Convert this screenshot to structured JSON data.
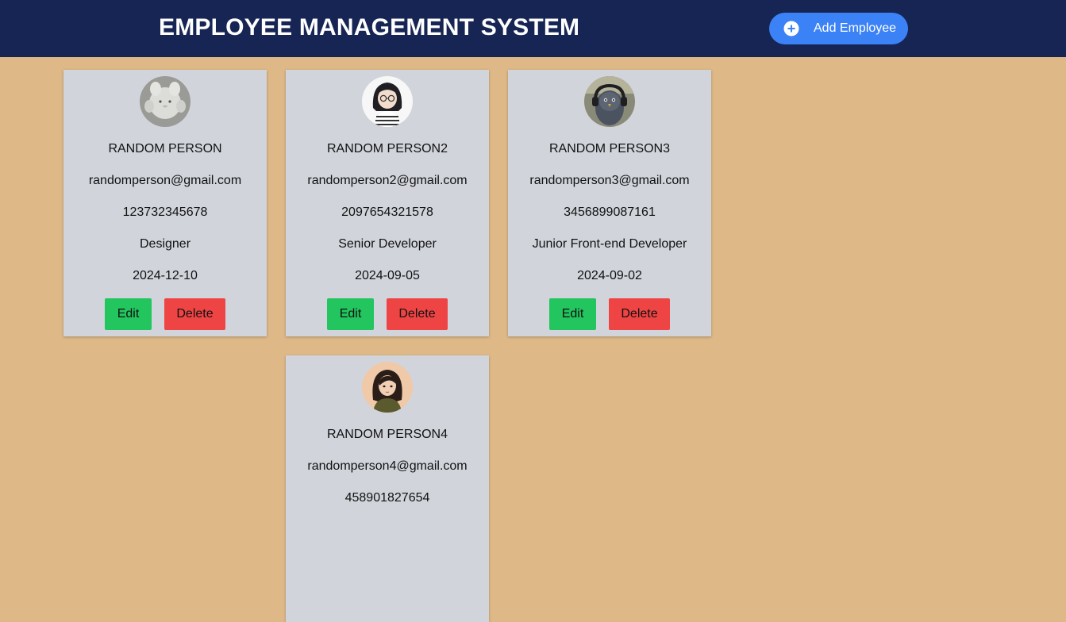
{
  "header": {
    "title": "EMPLOYEE MANAGEMENT SYSTEM",
    "add_button_label": "Add Employee"
  },
  "colors": {
    "header_bg": "#172554",
    "page_bg": "#deb887",
    "card_bg": "#d1d5db",
    "add_button": "#3b82f6",
    "edit_button": "#22c55e",
    "delete_button": "#ef4444"
  },
  "employees": [
    {
      "name": "RANDOM PERSON",
      "email": "randomperson@gmail.com",
      "phone": "123732345678",
      "role": "Designer",
      "date": "2024-12-10",
      "avatar": "plush-toy-photo",
      "edit_label": "Edit",
      "delete_label": "Delete"
    },
    {
      "name": "RANDOM PERSON2",
      "email": "randomperson2@gmail.com",
      "phone": "2097654321578",
      "role": "Senior Developer",
      "date": "2024-09-05",
      "avatar": "illustrated-girl-glasses",
      "edit_label": "Edit",
      "delete_label": "Delete"
    },
    {
      "name": "RANDOM PERSON3",
      "email": "randomperson3@gmail.com",
      "phone": "3456899087161",
      "role": "Junior Front-end Developer",
      "date": "2024-09-02",
      "avatar": "bird-with-headphones-photo",
      "edit_label": "Edit",
      "delete_label": "Delete"
    },
    {
      "name": "RANDOM PERSON4",
      "email": "randomperson4@gmail.com",
      "phone": "458901827654",
      "role": "",
      "date": "",
      "avatar": "illustrated-woman-dark-hair",
      "edit_label": "",
      "delete_label": ""
    }
  ]
}
